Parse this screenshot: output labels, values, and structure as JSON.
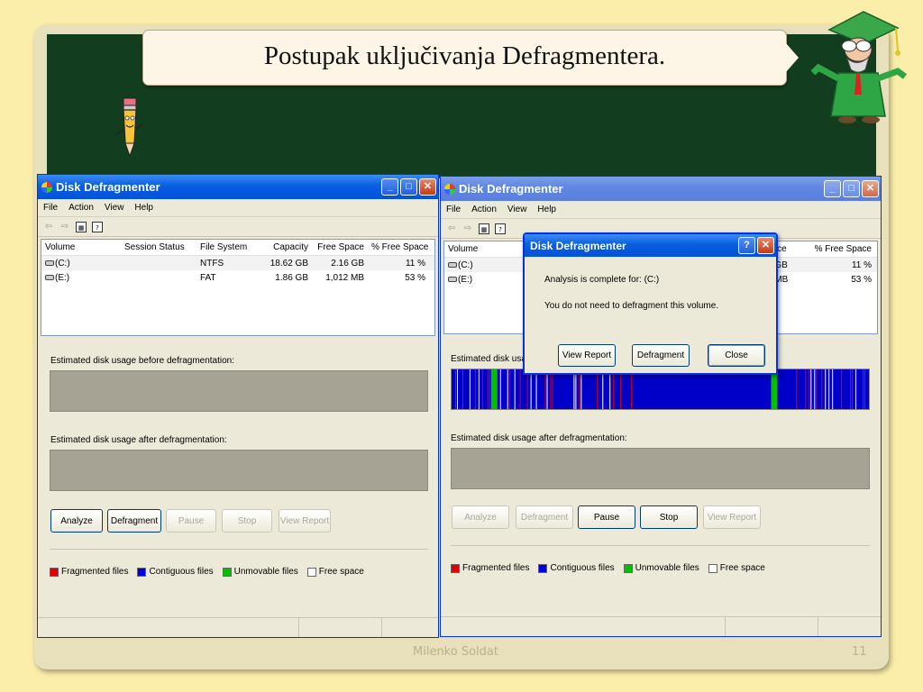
{
  "slide": {
    "title": "Postupak uključivanja Defragmentera.",
    "author": "Milenko Soldat",
    "page_number": "11"
  },
  "window_left": {
    "title": "Disk Defragmenter",
    "menu": [
      "File",
      "Action",
      "View",
      "Help"
    ],
    "columns": [
      "Volume",
      "Session Status",
      "File System",
      "Capacity",
      "Free Space",
      "% Free Space"
    ],
    "rows": [
      {
        "volume": "(C:)",
        "status": "",
        "fs": "NTFS",
        "capacity": "18.62 GB",
        "free": "2.16 GB",
        "pct": "11 %"
      },
      {
        "volume": "(E:)",
        "status": "",
        "fs": "FAT",
        "capacity": "1.86 GB",
        "free": "1,012 MB",
        "pct": "53 %"
      }
    ],
    "before_label": "Estimated disk usage before defragmentation:",
    "after_label": "Estimated disk usage after defragmentation:",
    "buttons": {
      "analyze": "Analyze",
      "defragment": "Defragment",
      "pause": "Pause",
      "stop": "Stop",
      "view_report": "View Report"
    },
    "legend": {
      "fragmented": "Fragmented files",
      "contiguous": "Contiguous files",
      "unmovable": "Unmovable files",
      "free": "Free space"
    }
  },
  "window_right": {
    "title": "Disk Defragmenter",
    "menu": [
      "File",
      "Action",
      "View",
      "Help"
    ],
    "columns": [
      "Volume",
      "pace",
      "% Free Space"
    ],
    "rows": [
      {
        "volume": "(C:)",
        "free_partial": "6 GB",
        "pct": "11 %"
      },
      {
        "volume": "(E:)",
        "free_partial": "2 MB",
        "pct": "53 %"
      }
    ],
    "before_label": "Estimated disk usage before defragmentation:",
    "after_label": "Estimated disk usage after defragmentation:",
    "buttons": {
      "analyze": "Analyze",
      "defragment": "Defragment",
      "pause": "Pause",
      "stop": "Stop",
      "view_report": "View Report"
    },
    "legend": {
      "fragmented": "Fragmented files",
      "contiguous": "Contiguous files",
      "unmovable": "Unmovable files",
      "free": "Free space"
    }
  },
  "dialog": {
    "title": "Disk Defragmenter",
    "line1": "Analysis is complete for: (C:)",
    "line2": "You do not need to defragment this volume.",
    "buttons": {
      "view_report": "View Report",
      "defragment": "Defragment",
      "close": "Close"
    }
  },
  "colors": {
    "fragmented": "#e00000",
    "contiguous": "#0000e0",
    "unmovable": "#00c000",
    "free": "#ffffff"
  }
}
